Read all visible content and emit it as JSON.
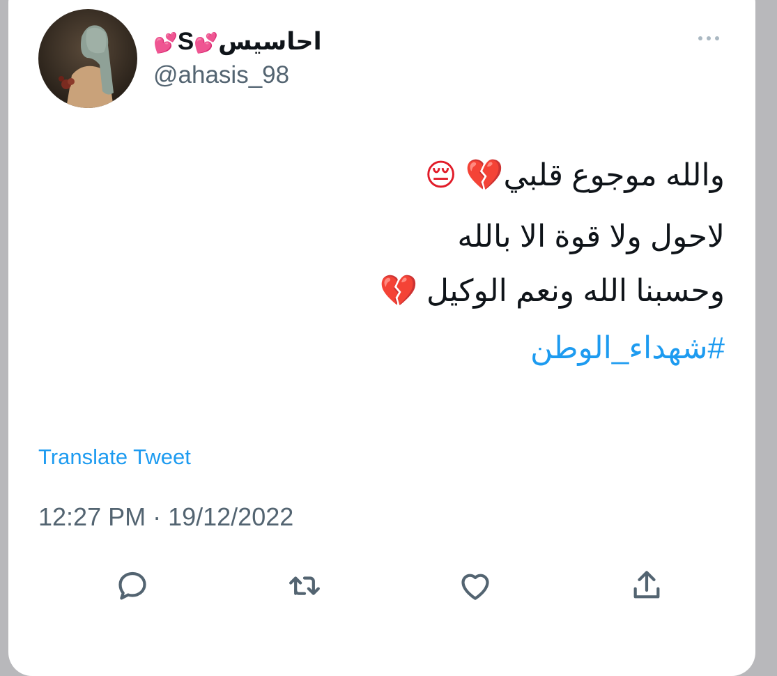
{
  "user": {
    "display_name": "احاسيس",
    "name_letter": "S",
    "heart_emoji": "💕",
    "handle": "@ahasis_98"
  },
  "tweet": {
    "line1": "والله موجوع قلبي",
    "line1_emoji": "💔 😔",
    "line2": "لاحول ولا قوة الا بالله",
    "line3": "وحسبنا الله ونعم الوكيل",
    "line3_emoji": "💔",
    "hashtag": "#شهداء_الوطن"
  },
  "translate_label": "Translate Tweet",
  "timestamp": "12:27 PM · 19/12/2022",
  "colors": {
    "accent": "#1d9bf0",
    "text": "#0f1419",
    "secondary": "#536471"
  },
  "icons": {
    "more": "more-horizontal-icon",
    "reply": "reply-icon",
    "retweet": "retweet-icon",
    "like": "like-icon",
    "share": "share-icon"
  }
}
